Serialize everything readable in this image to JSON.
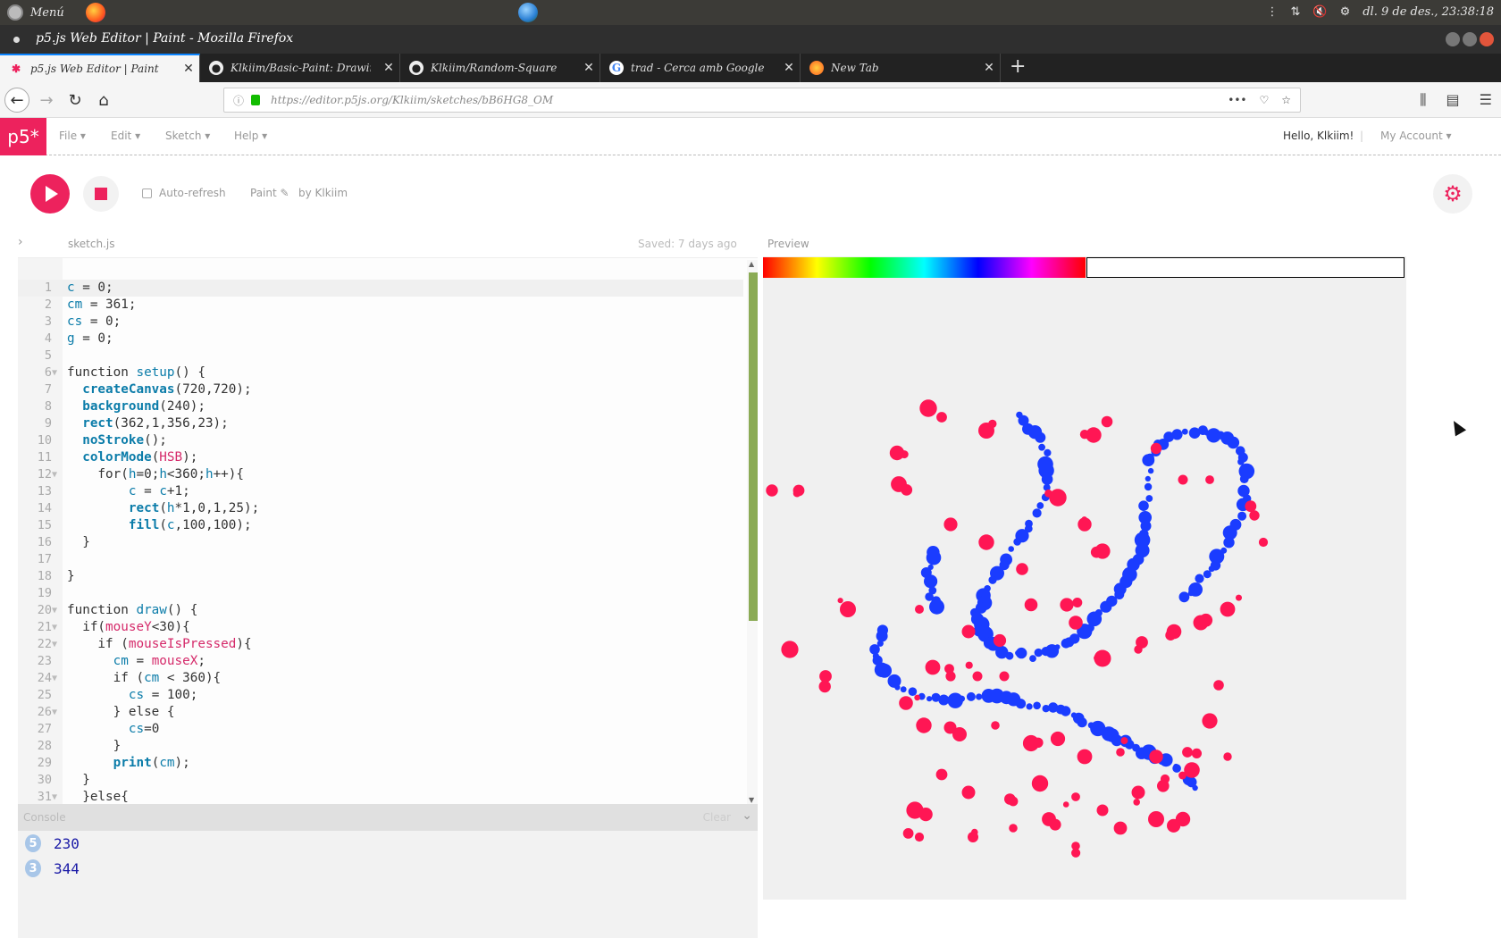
{
  "os": {
    "menu_label": "Menú",
    "clock": "dl. 9 de des., 23:38:18"
  },
  "window": {
    "title": "p5.js Web Editor | Paint - Mozilla Firefox"
  },
  "tabs": [
    {
      "label": "p5.js Web Editor | Paint",
      "icon": "p5-asterisk-icon",
      "color": "#ed225d",
      "active": true
    },
    {
      "label": "Klkiim/Basic-Paint: Drawing",
      "icon": "github-icon",
      "color": "#333333",
      "active": false
    },
    {
      "label": "Klkiim/Random-Square",
      "icon": "github-icon",
      "color": "#333333",
      "active": false
    },
    {
      "label": "trad - Cerca amb Google",
      "icon": "google-icon",
      "color": "#4285f4",
      "active": false
    },
    {
      "label": "New Tab",
      "icon": "firefox-icon",
      "color": "#ff7139",
      "active": false
    }
  ],
  "nav": {
    "url": "https://editor.p5js.org/Klkiim/sketches/bB6HG8_OM"
  },
  "p5": {
    "logo": "p5*",
    "menus": [
      "File",
      "Edit",
      "Sketch",
      "Help"
    ],
    "greeting": "Hello, Klkiim!",
    "account": "My Account",
    "auto_refresh": "Auto-refresh",
    "sketch_name": "Paint",
    "by": "by Klkiim",
    "file_name": "sketch.js",
    "saved": "Saved: 7 days ago",
    "preview_label": "Preview",
    "accent": "#ed225d"
  },
  "code": [
    {
      "n": "1",
      "fold": false,
      "html": "<span class='v'>c</span> = 0;"
    },
    {
      "n": "2",
      "fold": false,
      "html": "<span class='v'>cm</span> = 361;"
    },
    {
      "n": "3",
      "fold": false,
      "html": "<span class='v'>cs</span> = 0;"
    },
    {
      "n": "4",
      "fold": false,
      "html": "<span class='v'>g</span> = 0;"
    },
    {
      "n": "5",
      "fold": false,
      "html": ""
    },
    {
      "n": "6",
      "fold": true,
      "html": "function <span class='fn'>setup</span>() {"
    },
    {
      "n": "7",
      "fold": false,
      "html": "  <span class='f'>createCanvas</span>(720,720);"
    },
    {
      "n": "8",
      "fold": false,
      "html": "  <span class='f'>background</span>(240);"
    },
    {
      "n": "9",
      "fold": false,
      "html": "  <span class='f'>rect</span>(362,1,356,23);"
    },
    {
      "n": "10",
      "fold": false,
      "html": "  <span class='f'>noStroke</span>();"
    },
    {
      "n": "11",
      "fold": false,
      "html": "  <span class='f'>colorMode</span>(<span class='k'>HSB</span>);"
    },
    {
      "n": "12",
      "fold": true,
      "html": "    for(<span class='v'>h</span>=0;<span class='v'>h</span>&lt;360;<span class='v'>h</span>++){"
    },
    {
      "n": "13",
      "fold": false,
      "html": "        <span class='v'>c</span> = <span class='v'>c</span>+1;"
    },
    {
      "n": "14",
      "fold": false,
      "html": "        <span class='f'>rect</span>(<span class='v'>h</span>*1,0,1,25);"
    },
    {
      "n": "15",
      "fold": false,
      "html": "        <span class='f'>fill</span>(<span class='v'>c</span>,100,100);"
    },
    {
      "n": "16",
      "fold": false,
      "html": "  }"
    },
    {
      "n": "17",
      "fold": false,
      "html": ""
    },
    {
      "n": "18",
      "fold": false,
      "html": "}"
    },
    {
      "n": "19",
      "fold": false,
      "html": ""
    },
    {
      "n": "20",
      "fold": true,
      "html": "function <span class='fn'>draw</span>() {"
    },
    {
      "n": "21",
      "fold": true,
      "html": "  if(<span class='k'>mouseY</span>&lt;30){"
    },
    {
      "n": "22",
      "fold": true,
      "html": "    if (<span class='k'>mouseIsPressed</span>){"
    },
    {
      "n": "23",
      "fold": false,
      "html": "      <span class='v'>cm</span> = <span class='k'>mouseX</span>;"
    },
    {
      "n": "24",
      "fold": true,
      "html": "      if (<span class='v'>cm</span> &lt; 360){"
    },
    {
      "n": "25",
      "fold": false,
      "html": "        <span class='v'>cs</span> = 100;"
    },
    {
      "n": "26",
      "fold": true,
      "html": "      } else {"
    },
    {
      "n": "27",
      "fold": false,
      "html": "        <span class='v'>cs</span>=0"
    },
    {
      "n": "28",
      "fold": false,
      "html": "      }"
    },
    {
      "n": "29",
      "fold": false,
      "html": "      <span class='f'>print</span>(<span class='v'>cm</span>);"
    },
    {
      "n": "30",
      "fold": false,
      "html": "  }"
    },
    {
      "n": "31",
      "fold": true,
      "html": "  }else{"
    }
  ],
  "console": {
    "label": "Console",
    "clear": "Clear",
    "lines": [
      {
        "count": "5",
        "value": "230"
      },
      {
        "count": "3",
        "value": "344"
      }
    ]
  },
  "sketch_colors": {
    "red": "#ff1654",
    "blue": "#1a3cff"
  }
}
